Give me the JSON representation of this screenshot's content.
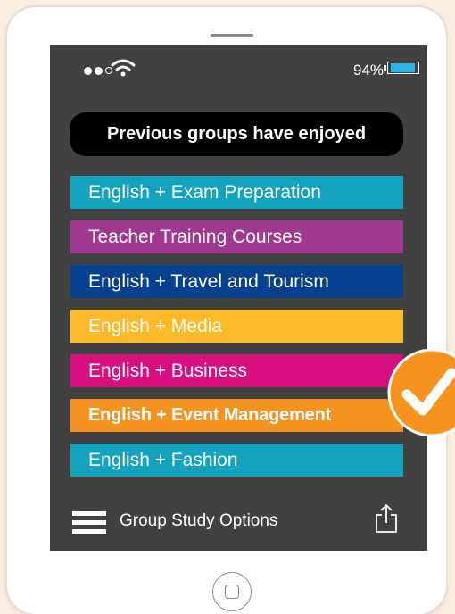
{
  "status_bar": {
    "battery_percent": "94%",
    "battery_level": 0.94,
    "signal_icon": "signal-dots-icon",
    "wifi_icon": "wifi-icon"
  },
  "heading": "Previous groups have enjoyed",
  "options": [
    {
      "label": "English + Exam Preparation",
      "color": "#13a3bf"
    },
    {
      "label": "Teacher Training Courses",
      "color": "#a1388f"
    },
    {
      "label": "English + Travel and Tourism",
      "color": "#06418f"
    },
    {
      "label": "English + Media",
      "color": "#fdb927"
    },
    {
      "label": "English + Business",
      "color": "#d8107f"
    },
    {
      "label": "English + Event Management",
      "color": "#f6921e",
      "selected": true
    },
    {
      "label": "English + Fashion",
      "color": "#13a3bf"
    }
  ],
  "bottom_bar": {
    "label": "Group Study Options",
    "menu_icon": "hamburger-menu-icon",
    "share_icon": "share-icon"
  },
  "checkmark": {
    "icon": "checkmark-icon",
    "color": "#f6921e"
  },
  "colors": {
    "background": "#fbeee2",
    "screen": "#414142",
    "device": "#ffffff"
  }
}
